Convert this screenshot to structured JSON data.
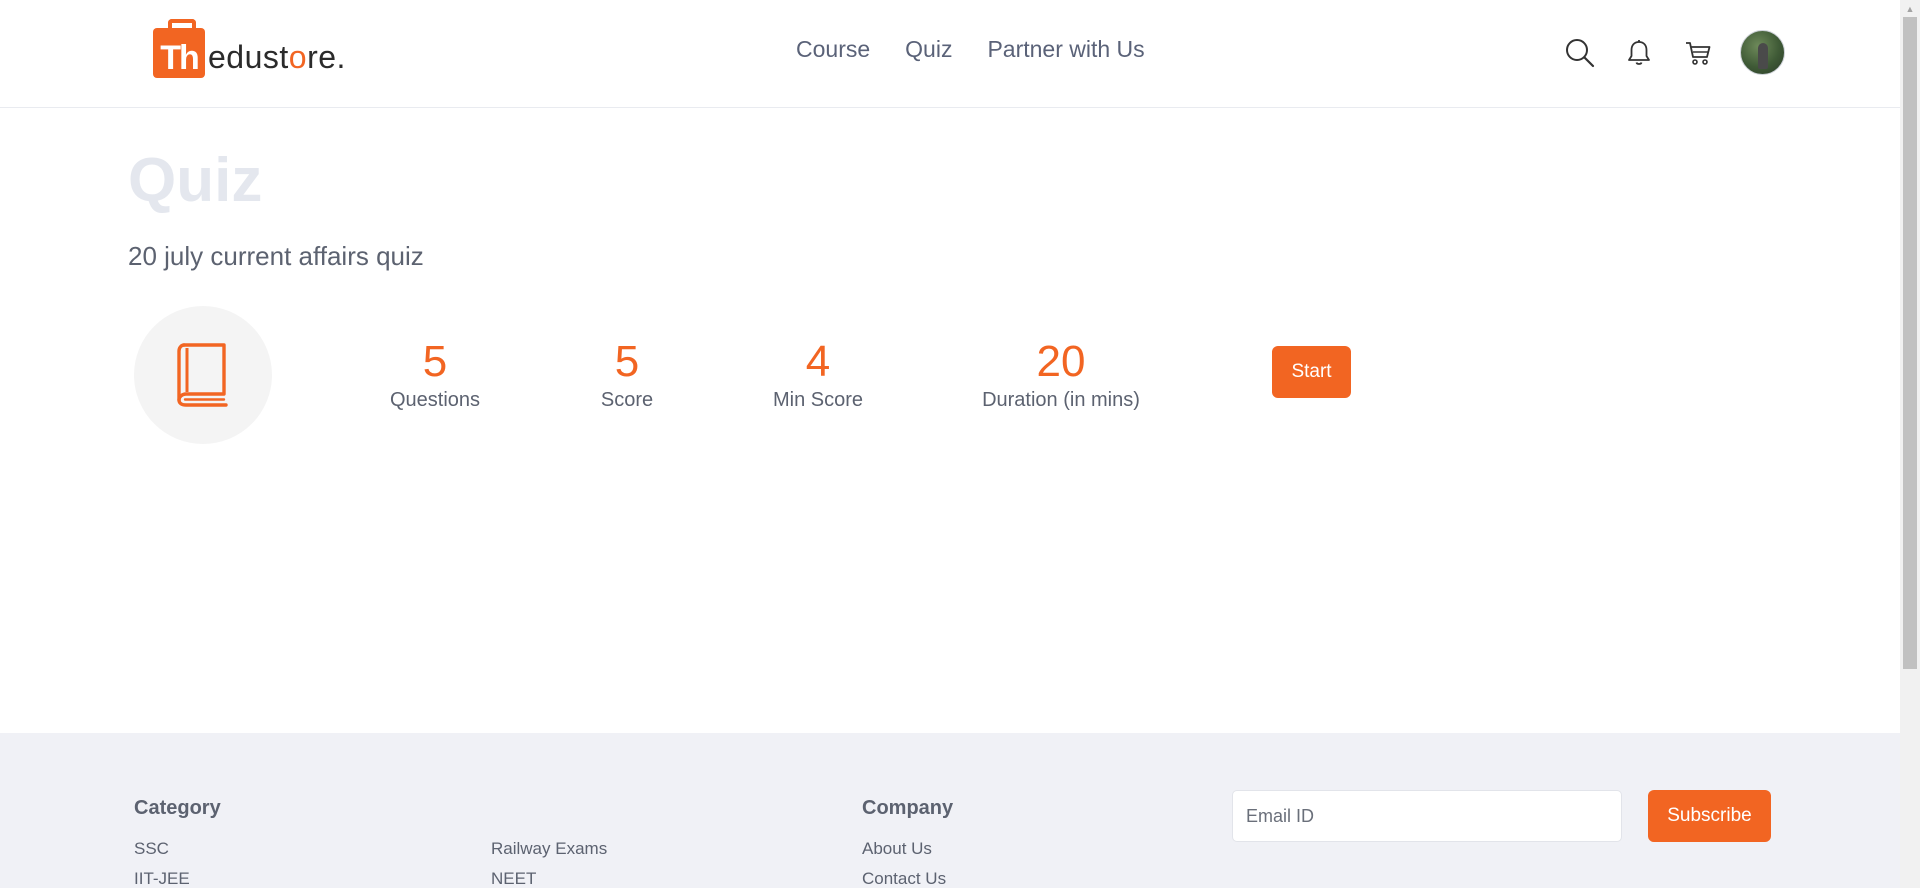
{
  "brand": {
    "badge_text": "Th",
    "name_part1": "edust",
    "name_o": "o",
    "name_part2": "re."
  },
  "nav": {
    "items": [
      "Course",
      "Quiz",
      "Partner with Us"
    ]
  },
  "header_icons": [
    "search-icon",
    "bell-icon",
    "cart-icon"
  ],
  "page": {
    "title": "Quiz",
    "quiz_name": "20 july current affairs quiz"
  },
  "stats": [
    {
      "value": "5",
      "label": "Questions"
    },
    {
      "value": "5",
      "label": "Score"
    },
    {
      "value": "4",
      "label": "Min Score"
    },
    {
      "value": "20",
      "label": "Duration (in mins)"
    }
  ],
  "start_label": "Start",
  "footer": {
    "category_heading": "Category",
    "category_col1": [
      "SSC",
      "IIT-JEE"
    ],
    "category_col2": [
      "Railway Exams",
      "NEET"
    ],
    "company_heading": "Company",
    "company_links": [
      "About Us",
      "Contact Us"
    ],
    "email_placeholder": "Email ID",
    "subscribe_label": "Subscribe"
  },
  "colors": {
    "accent": "#f26522",
    "footer_bg": "#f0f1f6",
    "title_muted": "#e4e7ee"
  }
}
